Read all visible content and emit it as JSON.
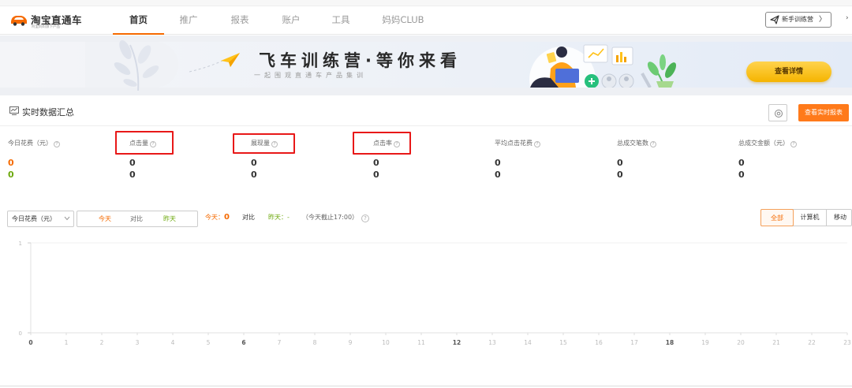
{
  "header": {
    "logo_name": "淘宝直通车",
    "logo_sub": "阿里妈妈旗下产品",
    "tabs": [
      {
        "label": "首页",
        "active": true
      },
      {
        "label": "推广"
      },
      {
        "label": "报表"
      },
      {
        "label": "账户"
      },
      {
        "label": "工具"
      },
      {
        "label": "妈妈CLUB"
      }
    ],
    "guide_label": "新手训练营",
    "guide_chevron": "〉",
    "more_label": "›"
  },
  "banner": {
    "title": "飞车训练营·等你来看",
    "subtitle": "一起围观直通车产品集训",
    "detail_button": "查看详情"
  },
  "realtime": {
    "title": "实时数据汇总",
    "report_button": "查看实时报表",
    "metrics": [
      {
        "label": "今日花费（元）",
        "today": "0",
        "yesterday": "0",
        "highlighted": false
      },
      {
        "label": "点击量",
        "today": "0",
        "yesterday": "0",
        "highlighted": true
      },
      {
        "label": "展现量",
        "today": "0",
        "yesterday": "0",
        "highlighted": true
      },
      {
        "label": "点击率",
        "today": "0",
        "yesterday": "0",
        "highlighted": true
      },
      {
        "label": "平均点击花费",
        "today": "0",
        "yesterday": "0",
        "highlighted": false
      },
      {
        "label": "总成交笔数",
        "today": "0",
        "yesterday": "0",
        "highlighted": false
      },
      {
        "label": "总成交金额（元）",
        "today": "0",
        "yesterday": "0",
        "highlighted": false
      }
    ]
  },
  "filters": {
    "metric_select": "今日花费（元）",
    "segments": {
      "today": "今天",
      "compare": "对比",
      "yesterday": "昨天"
    },
    "summary": {
      "today_label": "今天：",
      "today_value": "0",
      "compare_label": "对比",
      "yesterday_label": "昨天：",
      "yesterday_value": "-",
      "note": "（今天截止17:00）"
    },
    "view_options": [
      "全部",
      "计算机",
      "移动"
    ],
    "view_selected": "全部"
  },
  "colors": {
    "accent": "#f56a00",
    "yesterday": "#6ca80c",
    "highlight_box": "#e81818",
    "report_button": "#ff7a1a"
  },
  "chart_data": {
    "type": "line",
    "x": [
      "0",
      "1",
      "2",
      "3",
      "4",
      "5",
      "6",
      "7",
      "8",
      "9",
      "10",
      "11",
      "12",
      "13",
      "14",
      "15",
      "16",
      "17",
      "18",
      "19",
      "20",
      "21",
      "22",
      "23"
    ],
    "bold_ticks": [
      "0",
      "6",
      "12",
      "18"
    ],
    "y_ticks": [
      "0",
      "1"
    ],
    "ylim": [
      0,
      1
    ],
    "series": [],
    "grid": true
  }
}
